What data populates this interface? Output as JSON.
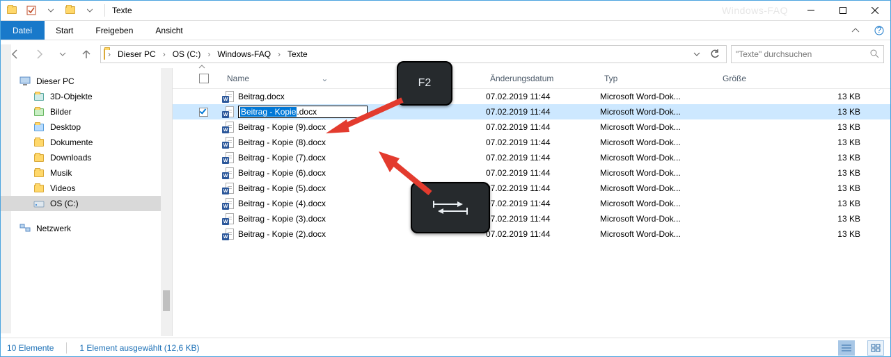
{
  "window": {
    "title": "Texte",
    "watermark": "Windows-FAQ"
  },
  "ribbon": {
    "file": "Datei",
    "tabs": [
      "Start",
      "Freigeben",
      "Ansicht"
    ]
  },
  "breadcrumbs": [
    "Dieser PC",
    "OS (C:)",
    "Windows-FAQ",
    "Texte"
  ],
  "search": {
    "placeholder": "\"Texte\" durchsuchen"
  },
  "sidebar": {
    "root": "Dieser PC",
    "items": [
      {
        "label": "3D-Objekte",
        "color": "teal"
      },
      {
        "label": "Bilder",
        "color": "green"
      },
      {
        "label": "Desktop",
        "color": "blue"
      },
      {
        "label": "Dokumente",
        "color": ""
      },
      {
        "label": "Downloads",
        "color": ""
      },
      {
        "label": "Musik",
        "color": ""
      },
      {
        "label": "Videos",
        "color": ""
      },
      {
        "label": "OS (C:)",
        "color": "drive",
        "selected": true
      }
    ],
    "network": "Netzwerk"
  },
  "columns": {
    "name": "Name",
    "date": "Änderungsdatum",
    "type": "Typ",
    "size": "Größe"
  },
  "rename": {
    "selected_part": "Beitrag - Kopie",
    "rest_part": ".docx"
  },
  "files": [
    {
      "name": "Beitrag.docx",
      "date": "07.02.2019 11:44",
      "type": "Microsoft Word-Dok...",
      "size": "13 KB",
      "selected": false,
      "editing": false
    },
    {
      "name": "Beitrag - Kopie.docx",
      "date": "07.02.2019 11:44",
      "type": "Microsoft Word-Dok...",
      "size": "13 KB",
      "selected": true,
      "editing": true
    },
    {
      "name": "Beitrag - Kopie (9).docx",
      "date": "07.02.2019 11:44",
      "type": "Microsoft Word-Dok...",
      "size": "13 KB",
      "selected": false,
      "editing": false
    },
    {
      "name": "Beitrag - Kopie (8).docx",
      "date": "07.02.2019 11:44",
      "type": "Microsoft Word-Dok...",
      "size": "13 KB",
      "selected": false,
      "editing": false
    },
    {
      "name": "Beitrag - Kopie (7).docx",
      "date": "07.02.2019 11:44",
      "type": "Microsoft Word-Dok...",
      "size": "13 KB",
      "selected": false,
      "editing": false
    },
    {
      "name": "Beitrag - Kopie (6).docx",
      "date": "07.02.2019 11:44",
      "type": "Microsoft Word-Dok...",
      "size": "13 KB",
      "selected": false,
      "editing": false
    },
    {
      "name": "Beitrag - Kopie (5).docx",
      "date": "07.02.2019 11:44",
      "type": "Microsoft Word-Dok...",
      "size": "13 KB",
      "selected": false,
      "editing": false
    },
    {
      "name": "Beitrag - Kopie (4).docx",
      "date": "07.02.2019 11:44",
      "type": "Microsoft Word-Dok...",
      "size": "13 KB",
      "selected": false,
      "editing": false
    },
    {
      "name": "Beitrag - Kopie (3).docx",
      "date": "07.02.2019 11:44",
      "type": "Microsoft Word-Dok...",
      "size": "13 KB",
      "selected": false,
      "editing": false
    },
    {
      "name": "Beitrag - Kopie (2).docx",
      "date": "07.02.2019 11:44",
      "type": "Microsoft Word-Dok...",
      "size": "13 KB",
      "selected": false,
      "editing": false
    }
  ],
  "status": {
    "count": "10 Elemente",
    "selection": "1 Element ausgewählt (12,6 KB)"
  },
  "keys": {
    "f2": "F2"
  }
}
